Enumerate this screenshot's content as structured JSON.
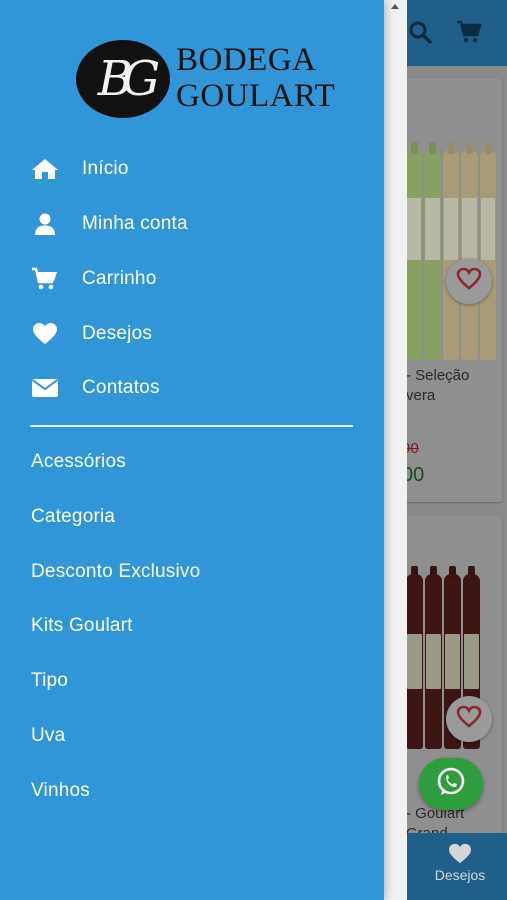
{
  "brand": {
    "monogram": "BG",
    "name_line1": "BODEGA",
    "name_line2": "GOULART"
  },
  "drawer": {
    "menu": [
      {
        "label": "Início",
        "icon": "home-icon"
      },
      {
        "label": "Minha conta",
        "icon": "user-icon"
      },
      {
        "label": "Carrinho",
        "icon": "cart-icon"
      },
      {
        "label": "Desejos",
        "icon": "heart-icon"
      },
      {
        "label": "Contatos",
        "icon": "envelope-icon"
      }
    ],
    "categories": [
      {
        "label": "Acessórios"
      },
      {
        "label": "Categoria"
      },
      {
        "label": "Desconto Exclusivo"
      },
      {
        "label": "Kits Goulart"
      },
      {
        "label": "Tipo"
      },
      {
        "label": "Uva"
      },
      {
        "label": "Vinhos"
      }
    ]
  },
  "background": {
    "header_icons": [
      "search-icon",
      "cart-icon"
    ],
    "card1": {
      "title_line1": "- Seleção",
      "title_line2": "vera",
      "old_price": "90",
      "new_price": "00"
    },
    "card2": {
      "title_line1": "- Goulart",
      "title_line2": "Grand"
    },
    "bottom_nav": {
      "wishlist_label": "Desejos"
    }
  },
  "colors": {
    "drawer_bg": "#3196d8",
    "overlay_bg": "#8a8a8a",
    "header_bg": "#1f5f8a",
    "whatsapp_green": "#2d9e3b"
  }
}
